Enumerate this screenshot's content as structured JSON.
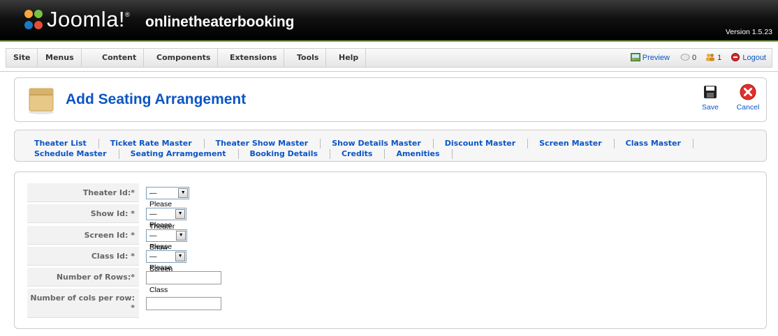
{
  "header": {
    "logo_text": "Joomla!",
    "site_name": "onlinetheaterbooking",
    "version": "Version 1.5.23"
  },
  "menu": {
    "items": [
      "Site",
      "Menus",
      "Content",
      "Components",
      "Extensions",
      "Tools",
      "Help"
    ]
  },
  "status": {
    "preview_label": "Preview",
    "messages_count": "0",
    "users_count": "1",
    "logout_label": "Logout"
  },
  "toolbar": {
    "title": "Add Seating Arrangement",
    "save_label": "Save",
    "cancel_label": "Cancel"
  },
  "submenu": {
    "row1": [
      "Theater List",
      "Ticket Rate Master",
      "Theater Show Master",
      "Show Details Master",
      "Discount Master",
      "Screen Master",
      "Class Master"
    ],
    "row2": [
      "Schedule Master",
      "Seating Arramgement",
      "Booking Details",
      "Credits",
      "Amenities"
    ]
  },
  "form": {
    "theater_label": "Theater Id:*",
    "theater_selected": "—Please select Theater Id—",
    "show_label": "Show Id: *",
    "show_selected": "—Please select Show Id—",
    "screen_label": "Screen Id: *",
    "screen_selected": "—Please select Screen Id—",
    "class_label": "Class Id: *",
    "class_selected": "—Please select Class Id—",
    "rows_label": "Number of Rows:*",
    "rows_value": "",
    "cols_label": "Number of cols per row: *",
    "cols_value": ""
  }
}
